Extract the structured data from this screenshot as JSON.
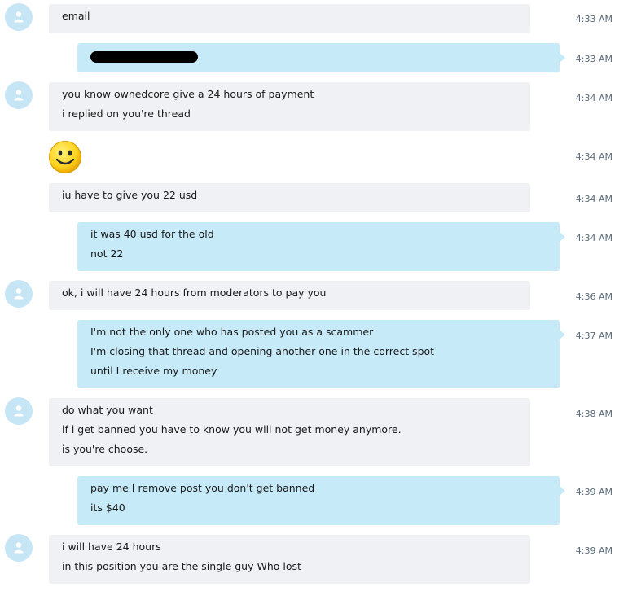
{
  "messages": [
    {
      "id": "m1",
      "side": "in",
      "avatar": true,
      "lines": [
        "email"
      ],
      "time": "4:33 AM"
    },
    {
      "id": "m2",
      "side": "out",
      "redacted": true,
      "lines": [],
      "time": "4:33 AM"
    },
    {
      "id": "m3",
      "side": "in",
      "avatar": true,
      "lines": [
        "you know ownedcore give a 24 hours of payment",
        "i replied on you're thread"
      ],
      "time": "4:34 AM"
    },
    {
      "id": "m4",
      "side": "in",
      "emoji": "smile-emoji",
      "lines": [],
      "time": "4:34 AM"
    },
    {
      "id": "m5",
      "side": "in",
      "lines": [
        "iu have to give you 22 usd"
      ],
      "time": "4:34 AM"
    },
    {
      "id": "m6",
      "side": "out",
      "lines": [
        "it was 40 usd for the old",
        "not 22"
      ],
      "time": "4:34 AM"
    },
    {
      "id": "m7",
      "side": "in",
      "avatar": true,
      "lines": [
        "ok, i will have 24 hours from moderators to pay you"
      ],
      "time": "4:36 AM"
    },
    {
      "id": "m8",
      "side": "out",
      "lines": [
        "I'm not the only one who has posted you as a scammer",
        "I'm closing that thread and opening another one in the correct spot",
        "until I receive my money"
      ],
      "time": "4:37 AM"
    },
    {
      "id": "m9",
      "side": "in",
      "avatar": true,
      "lines": [
        "do what you want",
        "if i get banned you have to know you will not get money anymore.",
        "is you're choose."
      ],
      "time": "4:38 AM"
    },
    {
      "id": "m10",
      "side": "out",
      "lines": [
        "pay me I remove post you don't get banned",
        "its $40"
      ],
      "time": "4:39 AM"
    },
    {
      "id": "m11",
      "side": "in",
      "avatar": true,
      "lines": [
        "i will have 24 hours",
        "in this position you are the single guy Who lost"
      ],
      "time": "4:39 AM"
    }
  ],
  "colors": {
    "incoming_bubble": "#eff1f5",
    "outgoing_bubble": "#c7eaf8",
    "avatar_bg": "#c7e6f5",
    "timestamp": "#5b6b7a"
  }
}
